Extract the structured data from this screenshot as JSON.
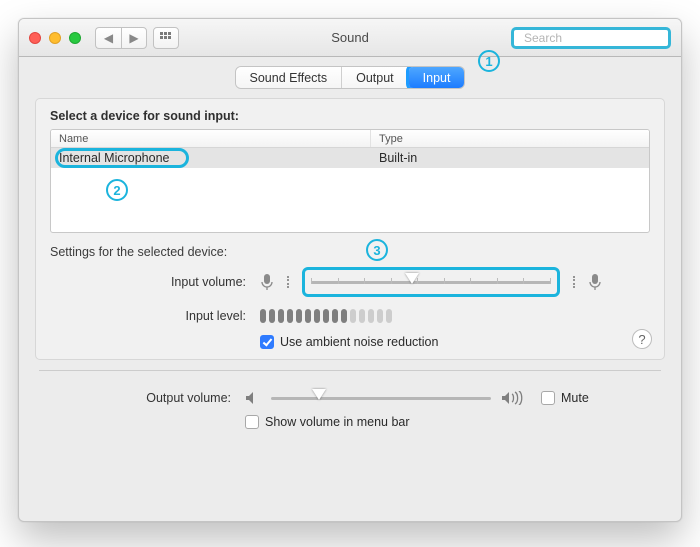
{
  "window": {
    "title": "Sound",
    "search_placeholder": "Search"
  },
  "tabs": {
    "effects": "Sound Effects",
    "output": "Output",
    "input": "Input",
    "selected": "input"
  },
  "input_panel": {
    "heading": "Select a device for sound input:",
    "columns": {
      "name": "Name",
      "type": "Type"
    },
    "devices": [
      {
        "name": "Internal Microphone",
        "type": "Built-in"
      }
    ],
    "settings_heading": "Settings for the selected device:",
    "input_volume_label": "Input volume:",
    "input_volume_percent": 42,
    "input_level_label": "Input level:",
    "input_level_active_bars": 10,
    "input_level_total_bars": 15,
    "ambient_checkbox_label": "Use ambient noise reduction",
    "ambient_checked": true
  },
  "output_row": {
    "label": "Output volume:",
    "value_percent": 22,
    "mute_label": "Mute",
    "mute_checked": false,
    "menubar_label": "Show volume in menu bar",
    "menubar_checked": false
  },
  "callouts": {
    "c1": "1",
    "c2": "2",
    "c3": "3"
  },
  "colors": {
    "accent": "#1d9cff",
    "highlight": "#1bb4dd"
  }
}
